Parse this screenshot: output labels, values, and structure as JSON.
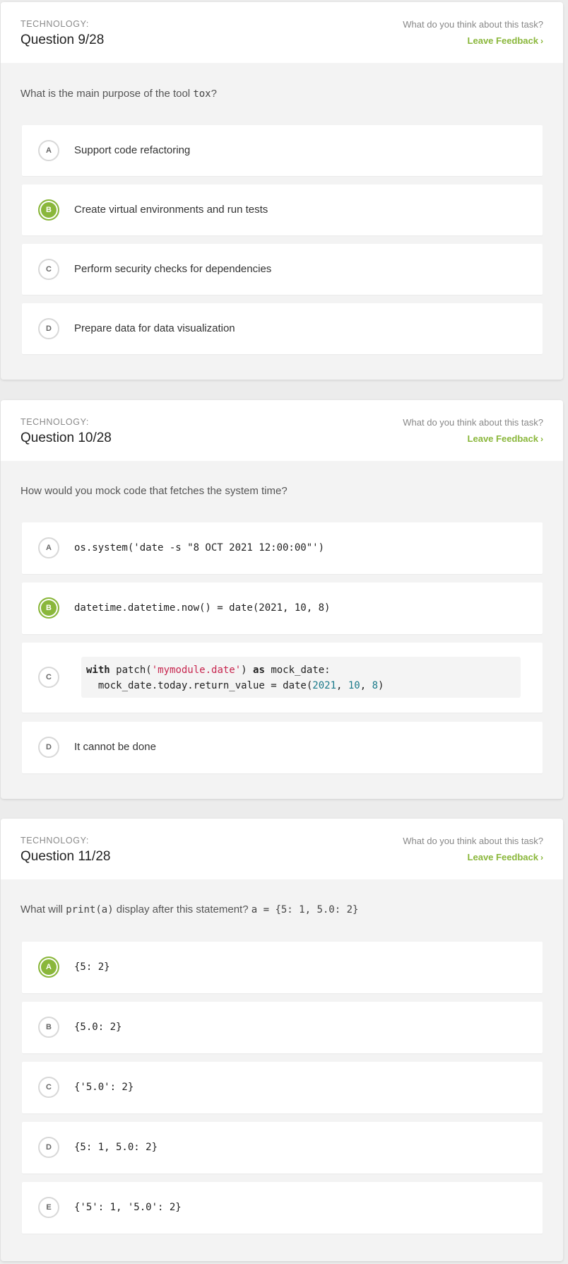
{
  "questions": [
    {
      "category": "TECHNOLOGY:",
      "number": "Question 9/28",
      "feedback_question": "What do you think about this task?",
      "feedback_link": "Leave Feedback",
      "prompt_pre": "What is the main purpose of the tool ",
      "prompt_code": "tox",
      "prompt_post": "?",
      "options": [
        {
          "letter": "A",
          "text": "Support code refactoring"
        },
        {
          "letter": "B",
          "text": "Create virtual environments and run tests",
          "selected": true
        },
        {
          "letter": "C",
          "text": "Perform security checks for dependencies"
        },
        {
          "letter": "D",
          "text": "Prepare data for data visualization"
        }
      ]
    },
    {
      "category": "TECHNOLOGY:",
      "number": "Question 10/28",
      "feedback_question": "What do you think about this task?",
      "feedback_link": "Leave Feedback",
      "prompt": "How would you mock code that fetches the system time?",
      "options": [
        {
          "letter": "A",
          "text": "os.system('date -s \"8 OCT 2021 12:00:00\"')"
        },
        {
          "letter": "B",
          "text": "datetime.datetime.now() = date(2021, 10, 8)",
          "selected": true
        },
        {
          "letter": "C",
          "code_line1_kw1": "with",
          "code_line1_mid": " patch(",
          "code_line1_str": "'mymodule.date'",
          "code_line1_end": ") ",
          "code_line1_kw2": "as",
          "code_line1_tail": " mock_date:",
          "code_line2_pre": "  mock_date.today.return_value = date(",
          "code_line2_n1": "2021",
          "code_line2_sep1": ", ",
          "code_line2_n2": "10",
          "code_line2_sep2": ", ",
          "code_line2_n3": "8",
          "code_line2_end": ")"
        },
        {
          "letter": "D",
          "text": "It cannot be done"
        }
      ]
    },
    {
      "category": "TECHNOLOGY:",
      "number": "Question 11/28",
      "feedback_question": "What do you think about this task?",
      "feedback_link": "Leave Feedback",
      "prompt_pre": "What will ",
      "prompt_code": "print(a)",
      "prompt_mid": " display after this statement? ",
      "prompt_code2": "a = {5: 1, 5.0: 2}",
      "options": [
        {
          "letter": "A",
          "text": "{5: 2}",
          "selected": true
        },
        {
          "letter": "B",
          "text": "{5.0: 2}"
        },
        {
          "letter": "C",
          "text": "{'5.0': 2}"
        },
        {
          "letter": "D",
          "text": "{5: 1, 5.0: 2}"
        },
        {
          "letter": "E",
          "text": "{'5': 1, '5.0': 2}"
        }
      ]
    }
  ],
  "colors": {
    "accent": "#8ab73b",
    "string": "#c7254e",
    "number": "#1b7a8a"
  },
  "icons": {
    "feedback_chevron": "chevron-right-icon"
  }
}
